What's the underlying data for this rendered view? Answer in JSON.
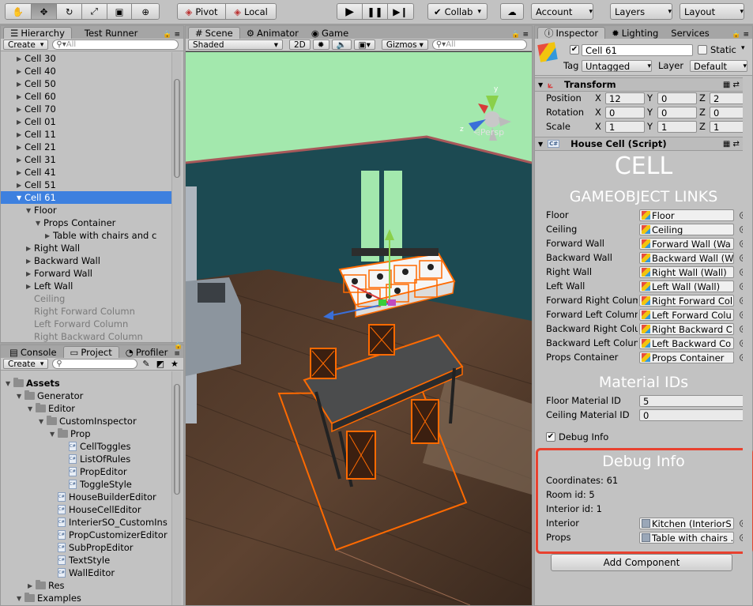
{
  "toolbar": {
    "pivot": "Pivot",
    "local": "Local",
    "collab": "Collab",
    "account": "Account",
    "layers": "Layers",
    "layout": "Layout"
  },
  "hierarchy": {
    "tab": "Hierarchy",
    "tab2": "Test Runner",
    "create": "Create",
    "search_placeholder": "All",
    "rows": [
      {
        "label": "Cell 30",
        "depth": 1,
        "arrow": "right",
        "state": "normal"
      },
      {
        "label": "Cell 40",
        "depth": 1,
        "arrow": "right",
        "state": "normal"
      },
      {
        "label": "Cell 50",
        "depth": 1,
        "arrow": "right",
        "state": "normal"
      },
      {
        "label": "Cell 60",
        "depth": 1,
        "arrow": "right",
        "state": "normal"
      },
      {
        "label": "Cell 70",
        "depth": 1,
        "arrow": "right",
        "state": "normal"
      },
      {
        "label": "Cell 01",
        "depth": 1,
        "arrow": "right",
        "state": "normal"
      },
      {
        "label": "Cell 11",
        "depth": 1,
        "arrow": "right",
        "state": "normal"
      },
      {
        "label": "Cell 21",
        "depth": 1,
        "arrow": "right",
        "state": "normal"
      },
      {
        "label": "Cell 31",
        "depth": 1,
        "arrow": "right",
        "state": "normal"
      },
      {
        "label": "Cell 41",
        "depth": 1,
        "arrow": "right",
        "state": "normal"
      },
      {
        "label": "Cell 51",
        "depth": 1,
        "arrow": "right",
        "state": "normal"
      },
      {
        "label": "Cell 61",
        "depth": 1,
        "arrow": "down",
        "state": "selected"
      },
      {
        "label": "Floor",
        "depth": 2,
        "arrow": "down",
        "state": "normal"
      },
      {
        "label": "Props Container",
        "depth": 3,
        "arrow": "down",
        "state": "normal"
      },
      {
        "label": "Table with chairs and c",
        "depth": 4,
        "arrow": "right",
        "state": "normal"
      },
      {
        "label": "Right Wall",
        "depth": 2,
        "arrow": "right",
        "state": "normal"
      },
      {
        "label": "Backward Wall",
        "depth": 2,
        "arrow": "right",
        "state": "normal"
      },
      {
        "label": "Forward Wall",
        "depth": 2,
        "arrow": "right",
        "state": "normal"
      },
      {
        "label": "Left Wall",
        "depth": 2,
        "arrow": "right",
        "state": "normal"
      },
      {
        "label": "Ceiling",
        "depth": 2,
        "arrow": "none",
        "state": "disabled"
      },
      {
        "label": "Right Forward Column",
        "depth": 2,
        "arrow": "none",
        "state": "disabled"
      },
      {
        "label": "Left Forward Column",
        "depth": 2,
        "arrow": "none",
        "state": "disabled"
      },
      {
        "label": "Right Backward Column",
        "depth": 2,
        "arrow": "none",
        "state": "disabled"
      }
    ]
  },
  "project": {
    "tab_console": "Console",
    "tab_project": "Project",
    "tab_profiler": "Profiler",
    "create": "Create",
    "rows": [
      {
        "label": "Assets",
        "depth": 0,
        "arrow": "down",
        "kind": "folder",
        "bold": true
      },
      {
        "label": "Generator",
        "depth": 1,
        "arrow": "down",
        "kind": "folder"
      },
      {
        "label": "Editor",
        "depth": 2,
        "arrow": "down",
        "kind": "folder"
      },
      {
        "label": "CustomInspector",
        "depth": 3,
        "arrow": "down",
        "kind": "folder"
      },
      {
        "label": "Prop",
        "depth": 4,
        "arrow": "down",
        "kind": "folder"
      },
      {
        "label": "CellToggles",
        "depth": 5,
        "arrow": "none",
        "kind": "script"
      },
      {
        "label": "ListOfRules",
        "depth": 5,
        "arrow": "none",
        "kind": "script"
      },
      {
        "label": "PropEditor",
        "depth": 5,
        "arrow": "none",
        "kind": "script"
      },
      {
        "label": "ToggleStyle",
        "depth": 5,
        "arrow": "none",
        "kind": "script"
      },
      {
        "label": "HouseBuilderEditor",
        "depth": 4,
        "arrow": "none",
        "kind": "script"
      },
      {
        "label": "HouseCellEditor",
        "depth": 4,
        "arrow": "none",
        "kind": "script"
      },
      {
        "label": "InterierSO_CustomIns",
        "depth": 4,
        "arrow": "none",
        "kind": "script"
      },
      {
        "label": "PropCustomizerEditor",
        "depth": 4,
        "arrow": "none",
        "kind": "script"
      },
      {
        "label": "SubPropEditor",
        "depth": 4,
        "arrow": "none",
        "kind": "script"
      },
      {
        "label": "TextStyle",
        "depth": 4,
        "arrow": "none",
        "kind": "script"
      },
      {
        "label": "WallEditor",
        "depth": 4,
        "arrow": "none",
        "kind": "script"
      },
      {
        "label": "Res",
        "depth": 2,
        "arrow": "right",
        "kind": "folder"
      },
      {
        "label": "Examples",
        "depth": 1,
        "arrow": "down",
        "kind": "folder"
      }
    ]
  },
  "scene": {
    "tab_scene": "Scene",
    "tab_animator": "Animator",
    "tab_game": "Game",
    "shading": "Shaded",
    "mode_2d": "2D",
    "gizmos": "Gizmos",
    "search_placeholder": "All",
    "persp": "Persp"
  },
  "inspector": {
    "tab": "Inspector",
    "tab_lighting": "Lighting",
    "tab_services": "Services",
    "object_name": "Cell 61",
    "static_label": "Static",
    "tag_label": "Tag",
    "tag_value": "Untagged",
    "layer_label": "Layer",
    "layer_value": "Default",
    "transform": {
      "title": "Transform",
      "rows": [
        {
          "label": "Position",
          "x": "12",
          "y": "0",
          "z": "2"
        },
        {
          "label": "Rotation",
          "x": "0",
          "y": "0",
          "z": "0"
        },
        {
          "label": "Scale",
          "x": "1",
          "y": "1",
          "z": "1"
        }
      ],
      "x_label": "X",
      "y_label": "Y",
      "z_label": "Z"
    },
    "script": {
      "title": "House Cell (Script)",
      "heading": "CELL",
      "links_heading": "GAMEOBJECT LINKS",
      "links": [
        {
          "label": "Floor",
          "value": "Floor"
        },
        {
          "label": "Ceiling",
          "value": "Ceiling"
        },
        {
          "label": "Forward Wall",
          "value": "Forward Wall (Wa"
        },
        {
          "label": "Backward Wall",
          "value": "Backward Wall (W"
        },
        {
          "label": "Right Wall",
          "value": "Right Wall (Wall)"
        },
        {
          "label": "Left Wall",
          "value": "Left Wall (Wall)"
        },
        {
          "label": "Forward Right Colum",
          "value": "Right Forward Col"
        },
        {
          "label": "Forward Left Column",
          "value": "Left Forward Colu"
        },
        {
          "label": "Backward Right Colu",
          "value": "Right Backward C"
        },
        {
          "label": "Backward Left Colun",
          "value": "Left Backward Co"
        },
        {
          "label": "Props Container",
          "value": "Props Container"
        }
      ],
      "material_heading": "Material IDs",
      "floor_material_label": "Floor Material ID",
      "floor_material_value": "5",
      "ceiling_material_label": "Ceiling Material ID",
      "ceiling_material_value": "0",
      "debug_toggle": "Debug Info",
      "debug_heading": "Debug Info",
      "coordinates": "Coordinates: 61",
      "room_id": "Room id: 5",
      "interior_id": "Interior id: 1",
      "interior_label": "Interior",
      "interior_value": "Kitchen (InteriorS",
      "props_label": "Props",
      "props_value": "Table with chairs ."
    },
    "add_component": "Add Component"
  },
  "colors": {
    "selection": "#3d80df",
    "highlight_box": "#e8412f",
    "selection_outline": "#ff6a00",
    "wall_teal": "#1c4a52",
    "sky_green": "#a3e8ad"
  }
}
